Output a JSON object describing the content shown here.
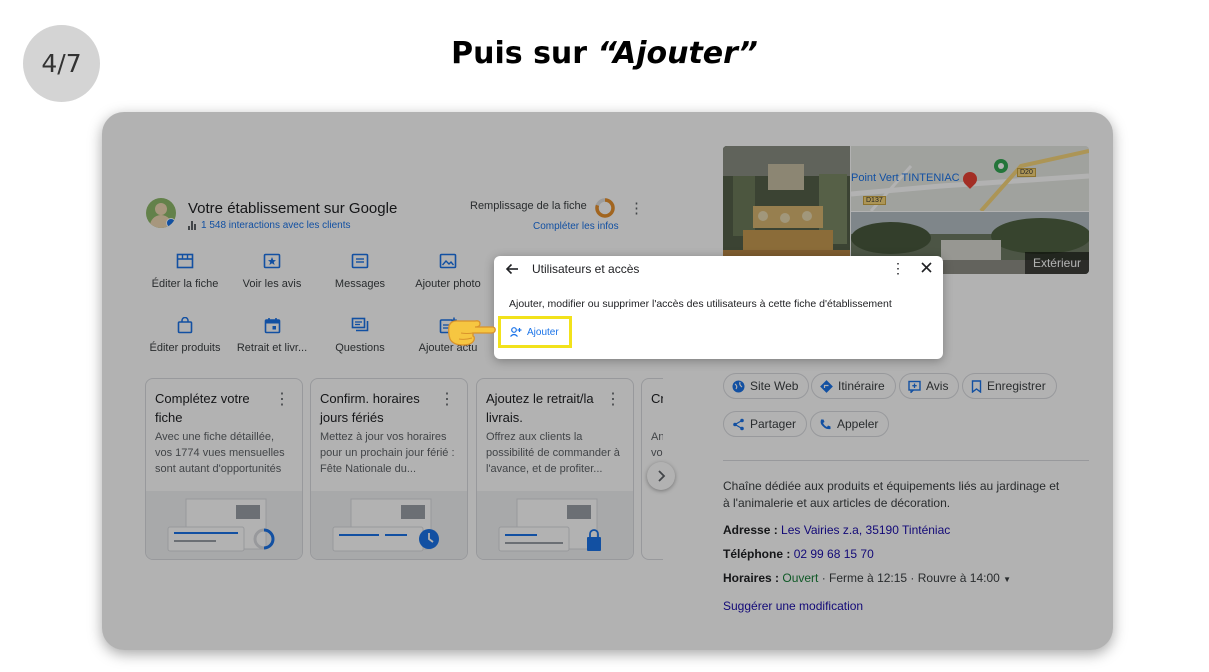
{
  "step": {
    "counter": "4/7",
    "title_prefix": "Puis sur ",
    "title_quote_open": "“",
    "title_emphasis": "Ajouter",
    "title_quote_close": "”"
  },
  "business": {
    "title": "Votre établissement sur Google",
    "interactions": "1 548 interactions avec les clients",
    "fill_label": "Remplissage de la fiche",
    "complete_link": "Compléter les infos",
    "fill_level": 0.8
  },
  "actions_row1": [
    {
      "label": "Éditer la fiche",
      "icon": "storefront-icon"
    },
    {
      "label": "Voir les avis",
      "icon": "star-icon"
    },
    {
      "label": "Messages",
      "icon": "message-icon"
    },
    {
      "label": "Ajouter photo",
      "icon": "photo-icon"
    }
  ],
  "actions_row2": [
    {
      "label": "Éditer produits",
      "icon": "shopping-bag-icon"
    },
    {
      "label": "Retrait et livr...",
      "icon": "calendar-icon"
    },
    {
      "label": "Questions",
      "icon": "question-icon"
    },
    {
      "label": "Ajouter actu",
      "icon": "post-add-icon"
    }
  ],
  "cards": [
    {
      "title": "Complétez votre fiche",
      "text": "Avec une fiche détaillée, vos 1774 vues mensuelles sont autant d'opportunités"
    },
    {
      "title": "Confirm. horaires jours fériés",
      "text": "Mettez à jour vos horaires pour un prochain jour férié : Fête Nationale du..."
    },
    {
      "title": "Ajoutez le retrait/la livrais.",
      "text": "Offrez aux clients la possibilité de commander à l'avance, et de profiter..."
    },
    {
      "title": "Cr",
      "text": "An vo"
    }
  ],
  "dialog": {
    "title": "Utilisateurs et accès",
    "description": "Ajouter, modifier ou supprimer l'accès des utilisateurs à cette fiche d'établissement",
    "add_label": "Ajouter"
  },
  "map": {
    "place_label": "Point Vert TINTENIAC",
    "road1": "D20",
    "road2": "D137",
    "exterior_label": "Extérieur"
  },
  "panel": {
    "pills_row1": [
      {
        "label": "Site Web",
        "icon": "globe-icon"
      },
      {
        "label": "Itinéraire",
        "icon": "directions-icon"
      },
      {
        "label": "Avis",
        "icon": "review-icon"
      },
      {
        "label": "Enregistrer",
        "icon": "bookmark-icon"
      }
    ],
    "pills_row2": [
      {
        "label": "Partager",
        "icon": "share-icon"
      },
      {
        "label": "Appeler",
        "icon": "phone-icon"
      }
    ],
    "description": "Chaîne dédiée aux produits et équipements liés au jardinage et à l'animalerie et aux articles de décoration.",
    "address_label": "Adresse :",
    "address": "Les Vairies z.a, 35190 Tinténiac",
    "phone_label": "Téléphone :",
    "phone": "02 99 68 15 70",
    "hours_label": "Horaires :",
    "hours_open": "Ouvert",
    "hours_rest": " · Ferme à 12:15 · Rouvre à 14:00",
    "suggest": "Suggérer une modification"
  },
  "colors": {
    "highlight": "#f2e21b",
    "accent": "#1a73e8",
    "link": "#1a0dab"
  }
}
